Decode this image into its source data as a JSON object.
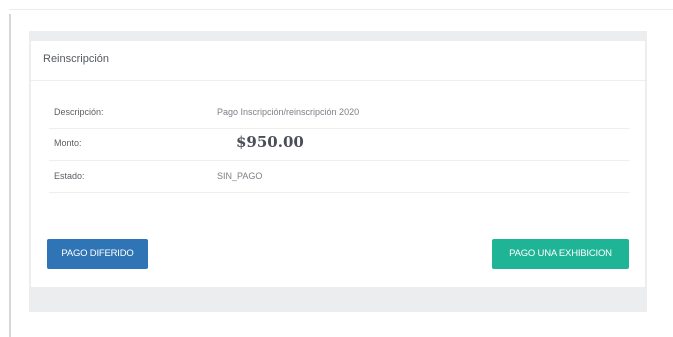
{
  "card": {
    "title": "Reinscripción"
  },
  "details": {
    "rows": [
      {
        "label": "Descripción:",
        "value": "Pago Inscripción/reinscripción 2020"
      },
      {
        "label": "Monto:",
        "value": "$950.00"
      },
      {
        "label": "Estado:",
        "value": "SIN_PAGO"
      }
    ]
  },
  "actions": {
    "deferred_label": "PAGO DIFERIDO",
    "single_label": "PAGO UNA EXHIBICION"
  },
  "colors": {
    "deferred_button": "#2f74b5",
    "single_button": "#20b496",
    "panel_background": "#ecedef"
  }
}
